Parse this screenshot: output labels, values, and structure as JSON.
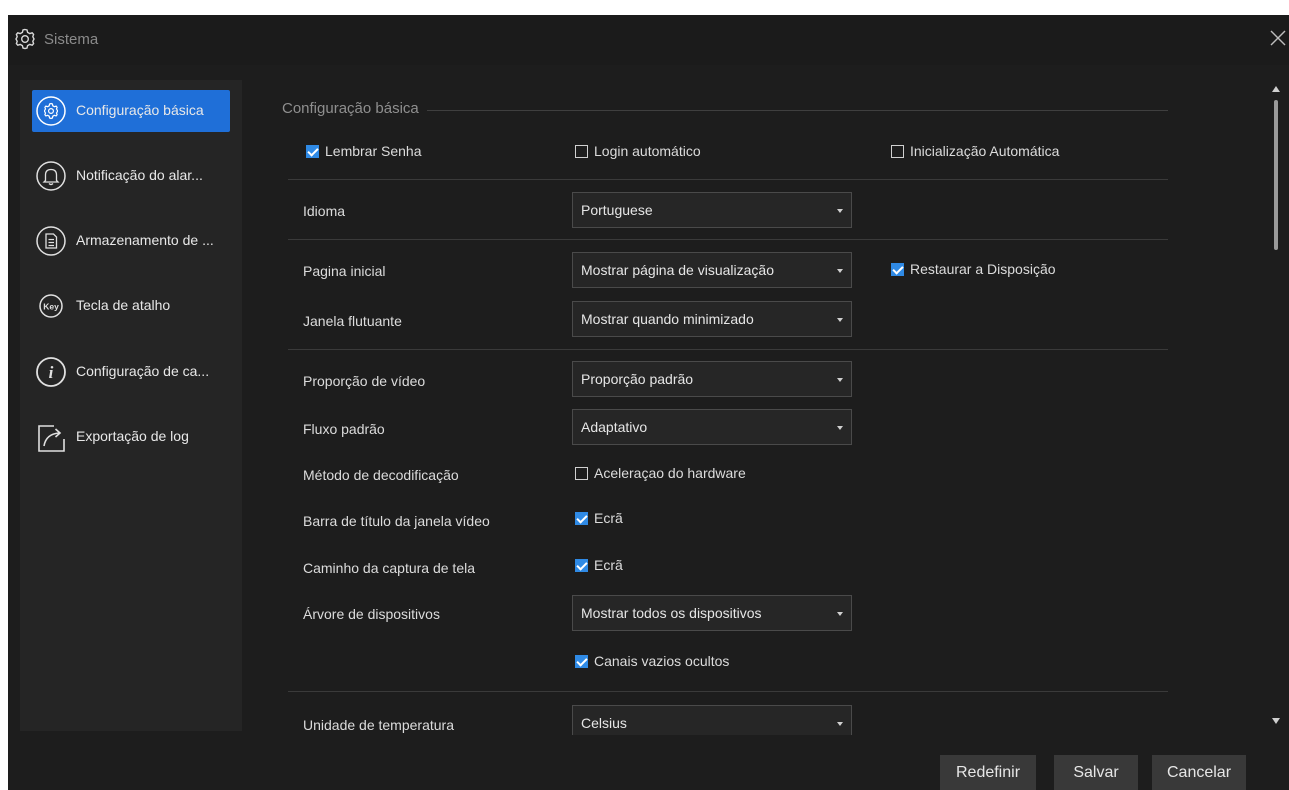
{
  "window": {
    "title": "Sistema",
    "title_icon": "gear-icon",
    "close_icon": "close-icon"
  },
  "sidebar": {
    "items": [
      {
        "label": "Configuração básica",
        "icon": "gear-icon",
        "active": true
      },
      {
        "label": "Notificação do alar...",
        "icon": "bell-icon"
      },
      {
        "label": "Armazenamento de ...",
        "icon": "document-icon"
      },
      {
        "label": "Tecla de atalho",
        "icon": "key-icon"
      },
      {
        "label": "Configuração de ca...",
        "icon": "info-icon"
      },
      {
        "label": "Exportação de log",
        "icon": "export-icon"
      }
    ]
  },
  "section": {
    "title": "Configuração básica"
  },
  "settings": {
    "remember_password": {
      "label": "Lembrar Senha",
      "checked": true
    },
    "auto_login": {
      "label": "Login automático",
      "checked": false
    },
    "auto_start": {
      "label": "Inicialização Automática",
      "checked": false
    },
    "language": {
      "label": "Idioma",
      "value": "Portuguese"
    },
    "home_page": {
      "label": "Pagina inicial",
      "value": "Mostrar página de visualização"
    },
    "restore_layout": {
      "label": "Restaurar a Disposição",
      "checked": true
    },
    "floating_window": {
      "label": "Janela flutuante",
      "value": "Mostrar quando minimizado"
    },
    "video_ratio": {
      "label": "Proporção de vídeo",
      "value": "Proporção padrão"
    },
    "default_stream": {
      "label": "Fluxo padrão",
      "value": "Adaptativo"
    },
    "decode_method": {
      "label": "Método de decodificação",
      "option_label": "Aceleraçao do hardware",
      "checked": false
    },
    "video_title_bar": {
      "label": "Barra de título da janela vídeo",
      "option_label": "Ecrã",
      "checked": true
    },
    "capture_path": {
      "label": "Caminho da captura de tela",
      "option_label": "Ecrã",
      "checked": true
    },
    "device_tree": {
      "label": "Árvore de dispositivos",
      "value": "Mostrar todos os dispositivos"
    },
    "hide_empty_channels": {
      "label": "Canais vazios ocultos",
      "checked": true
    },
    "temperature_unit": {
      "label": "Unidade de temperatura",
      "value": "Celsius"
    }
  },
  "footer": {
    "reset": "Redefinir",
    "save": "Salvar",
    "cancel": "Cancelar"
  },
  "colors": {
    "accent": "#1f6fd8",
    "checkbox": "#2f8ae5",
    "background": "#1d1d1d",
    "sidebar": "#252525"
  }
}
